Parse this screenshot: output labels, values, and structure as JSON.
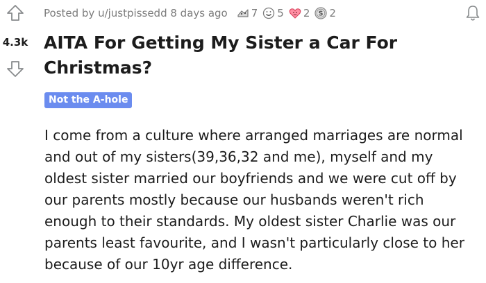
{
  "vote": {
    "score": "4.3k"
  },
  "meta": {
    "posted_by": "Posted by u/justpissedd 8 days ago",
    "awards": [
      {
        "icon": "helpful-award-icon",
        "count": "7"
      },
      {
        "icon": "wholesome-award-icon",
        "count": "5"
      },
      {
        "icon": "heartwarming-award-icon",
        "count": "2"
      },
      {
        "icon": "silver-award-icon",
        "count": "2"
      }
    ]
  },
  "post": {
    "title": "AITA For Getting My Sister a Car For Christmas?",
    "flair": "Not the A-hole",
    "body": "I come from a culture where arranged marriages are normal and out of my sisters(39,36,32 and me), myself and my oldest sister married our boyfriends and we were cut off by our parents mostly because our husbands weren't rich enough to their standards. My oldest sister Charlie was our parents least favourite, and I wasn't particularly close to her because of our 10yr age difference."
  },
  "colors": {
    "flair_bg": "#6b8cef",
    "meta_text": "#7c7c7c",
    "text": "#1c1c1c"
  }
}
